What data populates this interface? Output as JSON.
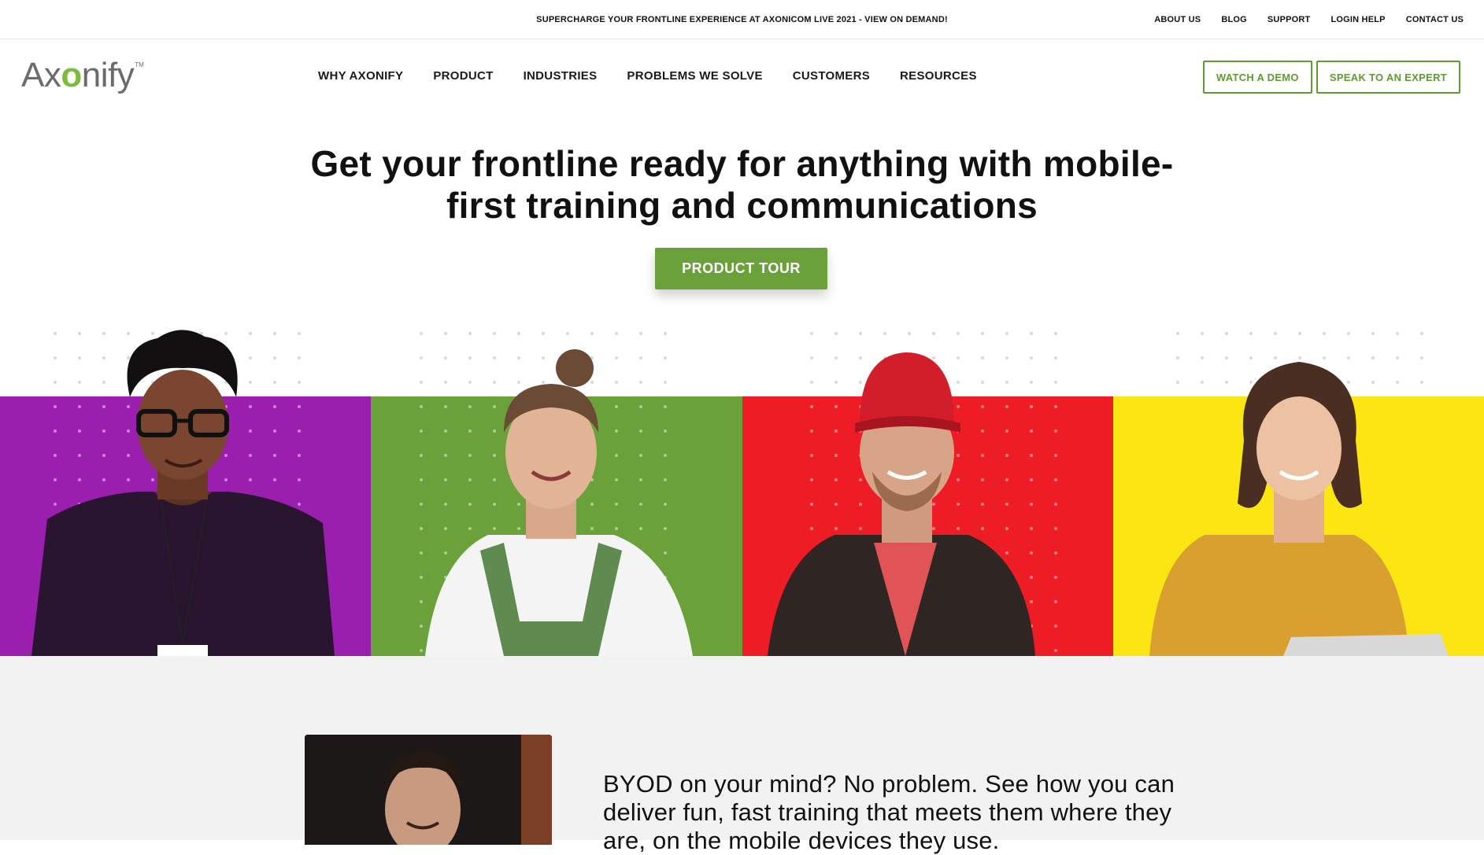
{
  "topbar": {
    "promo": "SUPERCHARGE YOUR FRONTLINE EXPERIENCE AT AXONICOM LIVE 2021 - VIEW ON DEMAND!",
    "links": [
      "ABOUT US",
      "BLOG",
      "SUPPORT",
      "LOGIN HELP",
      "CONTACT US"
    ]
  },
  "logo": {
    "text_before": "Ax",
    "text_o": "o",
    "text_after": "nify",
    "tm": "TM"
  },
  "nav": {
    "items": [
      "WHY AXONIFY",
      "PRODUCT",
      "INDUSTRIES",
      "PROBLEMS WE SOLVE",
      "CUSTOMERS",
      "RESOURCES"
    ],
    "watch_demo": "WATCH A DEMO",
    "speak_expert": "SPEAK TO AN EXPERT"
  },
  "hero": {
    "headline_bold": "Get your frontline ready for anything",
    "headline_rest": " with mobile-first training and communications",
    "cta": "PRODUCT TOUR"
  },
  "panels": {
    "colors": [
      "#9b1fae",
      "#6aa13a",
      "#ee1c25",
      "#fbe614"
    ]
  },
  "lower": {
    "text": "BYOD on your mind? No problem. See how you can deliver fun, fast training that meets them where they are, on the mobile devices they use."
  },
  "colors": {
    "brand_green": "#6aa13a",
    "outline_green": "#5f9a32"
  }
}
